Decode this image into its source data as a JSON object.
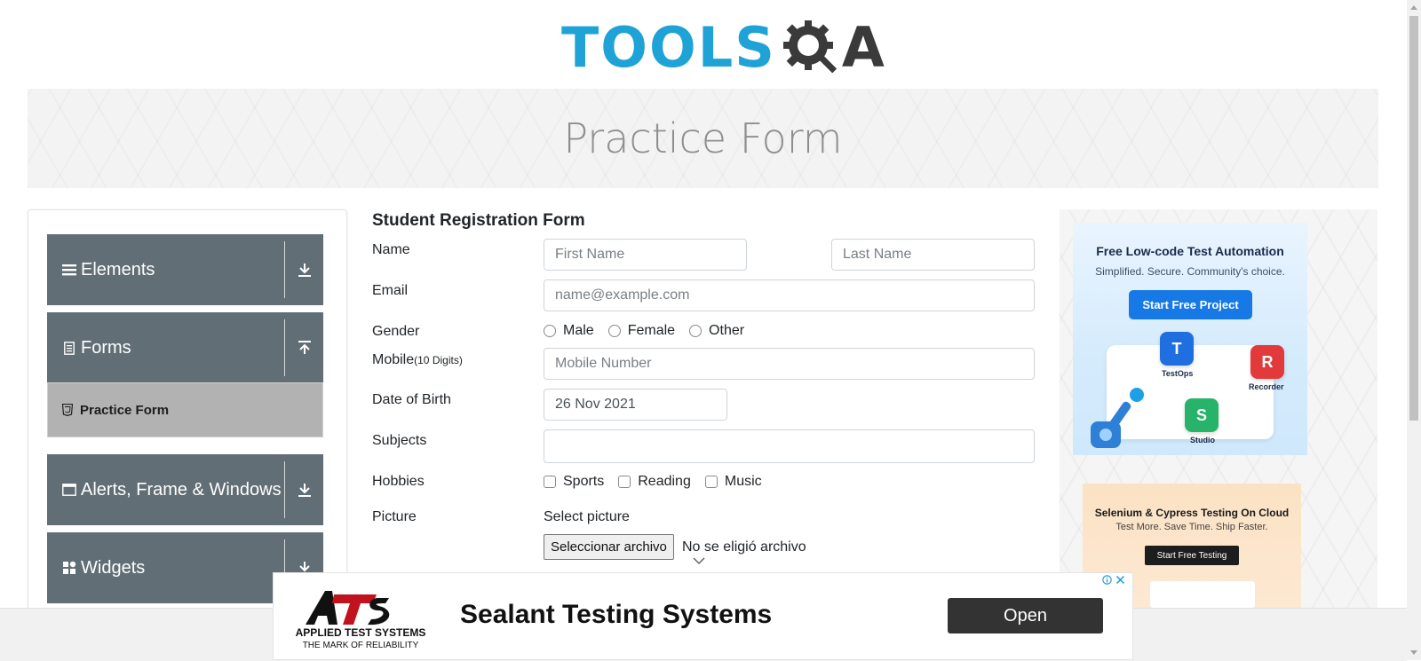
{
  "header": {
    "logo_text": "TOOLS",
    "logo_suffix": "A"
  },
  "banner": {
    "title": "Practice Form"
  },
  "sidebar": {
    "groups": [
      {
        "label": "Elements",
        "icon": "hamburger-icon",
        "state": "collapsed"
      },
      {
        "label": "Forms",
        "icon": "document-icon",
        "state": "expanded"
      },
      {
        "label": "Alerts, Frame & Windows",
        "icon": "window-icon",
        "state": "collapsed"
      },
      {
        "label": "Widgets",
        "icon": "widgets-icon",
        "state": "collapsed"
      }
    ],
    "forms_items": [
      {
        "label": "Practice Form",
        "active": true
      }
    ]
  },
  "form": {
    "title": "Student Registration Form",
    "name_label": "Name",
    "first_name_placeholder": "First Name",
    "last_name_placeholder": "Last Name",
    "email_label": "Email",
    "email_placeholder": "name@example.com",
    "gender_label": "Gender",
    "gender_options": [
      "Male",
      "Female",
      "Other"
    ],
    "mobile_label": "Mobile",
    "mobile_hint": "(10 Digits)",
    "mobile_placeholder": "Mobile Number",
    "dob_label": "Date of Birth",
    "dob_value": "26 Nov 2021",
    "subjects_label": "Subjects",
    "hobbies_label": "Hobbies",
    "hobbies_options": [
      "Sports",
      "Reading",
      "Music"
    ],
    "picture_label": "Picture",
    "select_picture_label": "Select picture",
    "file_button": "Seleccionar archivo",
    "file_status": "No se eligió archivo"
  },
  "ads": {
    "ad1": {
      "title": "Free Low-code Test Automation",
      "subtitle": "Simplified. Secure. Community's choice.",
      "button": "Start Free Project",
      "products": [
        "TestOps",
        "Recorder",
        "Studio"
      ]
    },
    "ad2": {
      "title": "Selenium & Cypress Testing On Cloud",
      "subtitle": "Test More. Save Time. Ship Faster.",
      "button": "Start Free Testing"
    },
    "bottom": {
      "company": "APPLIED TEST SYSTEMS",
      "tagline": "THE MARK OF RELIABILITY",
      "title": "Sealant Testing Systems",
      "button": "Open"
    }
  },
  "colors": {
    "logo_blue": "#1fa2d6",
    "sidebar_group": "#626e75",
    "sidebar_active": "#b2b2b2",
    "ad_button_blue": "#1779e6"
  }
}
